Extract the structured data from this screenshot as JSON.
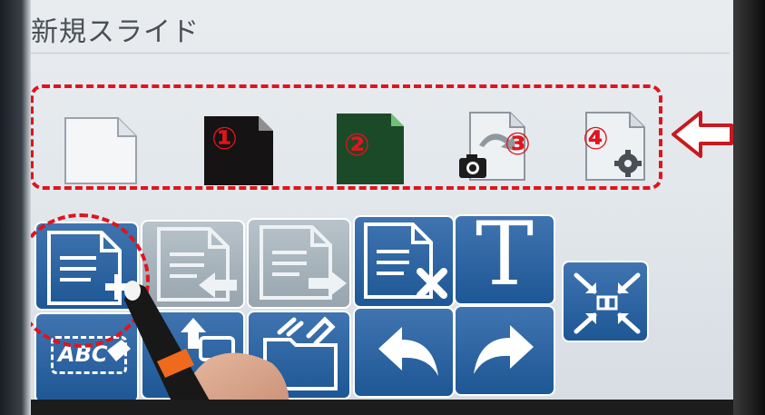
{
  "title": "新規スライド",
  "templates": [
    {
      "name": "blank-white"
    },
    {
      "name": "blank-black",
      "marker": "①"
    },
    {
      "name": "blank-green",
      "marker": "②"
    },
    {
      "name": "from-camera",
      "marker": "③"
    },
    {
      "name": "from-settings",
      "marker": "④"
    }
  ],
  "tools": {
    "text_tool_glyph": "T",
    "spell_label": "ABC"
  },
  "colors": {
    "annotation_red": "#e0141d",
    "button_blue": "#2a66a6",
    "button_gray": "#a8b4bd"
  }
}
